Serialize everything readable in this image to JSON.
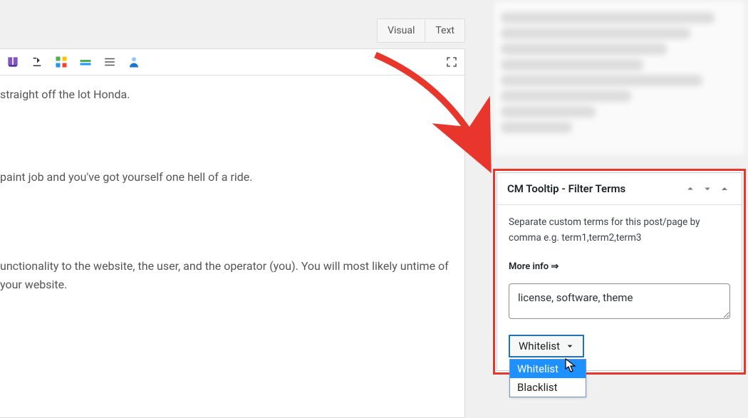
{
  "editor": {
    "tabs": {
      "visual": "Visual",
      "text": "Text"
    },
    "content": {
      "line1": "straight off the lot Honda.",
      "line2": "paint job and you've got yourself one hell of a ride.",
      "line3": "unctionality to the website, the user, and the operator (you). You will most likely untime of your website."
    }
  },
  "panel": {
    "title": "CM Tooltip - Filter Terms",
    "description": "Separate custom terms for this post/page by comma e.g. term1,term2,term3",
    "more_info": "More info ⇒",
    "terms_value": "license, software, theme",
    "select": {
      "current": "Whitelist",
      "options": [
        "Whitelist",
        "Blacklist"
      ]
    }
  }
}
